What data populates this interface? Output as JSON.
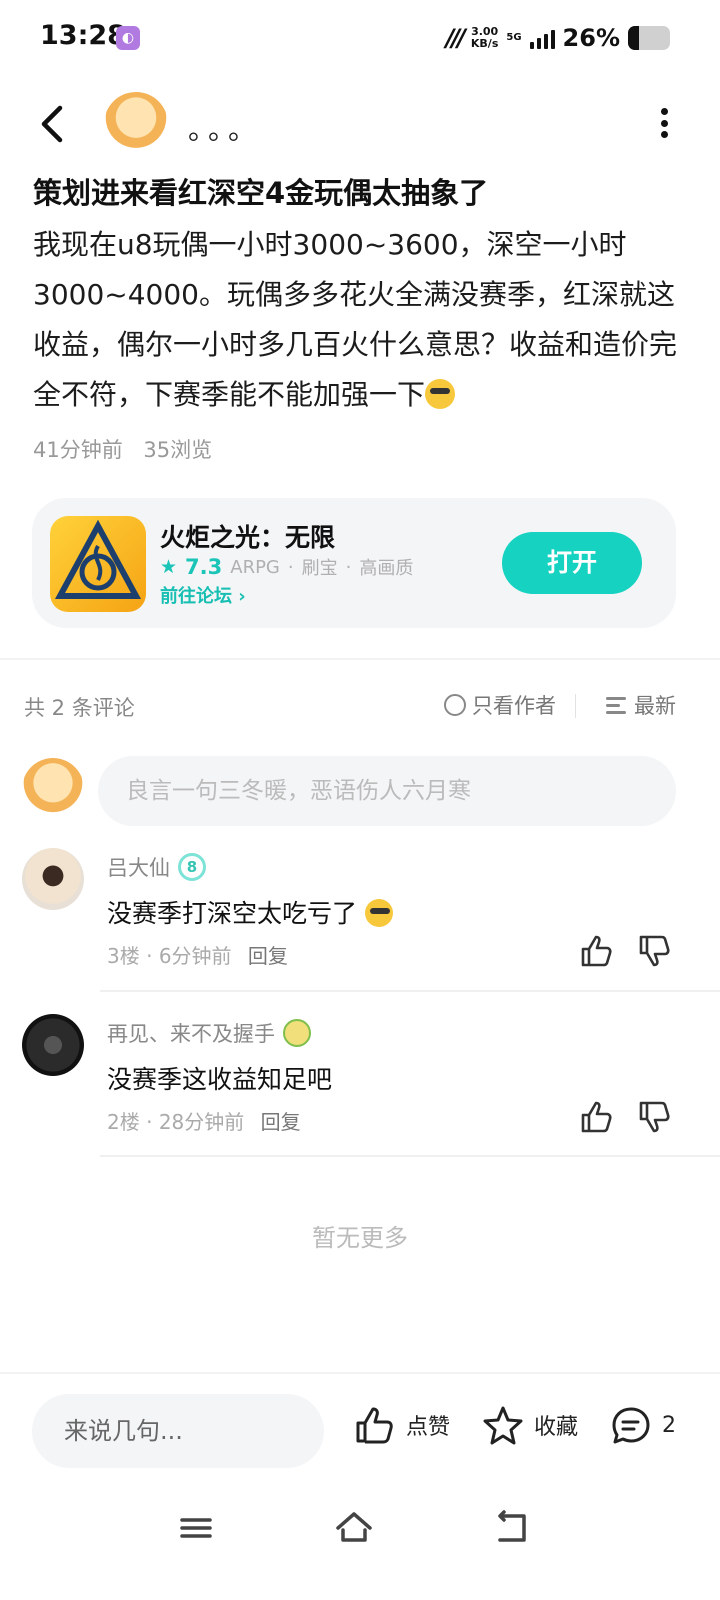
{
  "status_bar": {
    "time": "13:28",
    "net_speed_value": "3.00",
    "net_speed_unit": "KB/s",
    "network_type": "5G",
    "battery_percent": "26%",
    "battery_level": 0.26
  },
  "header": {
    "author_name": "。。。"
  },
  "post": {
    "title": "策划进来看红深空4金玩偶太抽象了",
    "body": "我现在u8玩偶一小时3000~3600，深空一小时3000~4000。玩偶多多花火全满没赛季，红深就这收益，偶尔一小时多几百火什么意思？收益和造价完全不符，下赛季能不能加强一下",
    "time_ago": "41分钟前",
    "views": "35浏览"
  },
  "game_card": {
    "name": "火炬之光：无限",
    "score": "7.3",
    "tags": [
      "ARPG",
      "刷宝",
      "高画质"
    ],
    "forum_link": "前往论坛",
    "open_label": "打开",
    "accent_color": "#16d2c0"
  },
  "comments_section": {
    "count_label": "共 2 条评论",
    "only_author_label": "只看作者",
    "sort_label": "最新",
    "input_placeholder": "良言一句三冬暖，恶语伤人六月寒",
    "no_more": "暂无更多",
    "items": [
      {
        "name": "吕大仙",
        "level": "8",
        "text": "没赛季打深空太吃亏了",
        "floor": "3楼",
        "time": "6分钟前",
        "reply": "回复"
      },
      {
        "name": "再见、来不及握手",
        "text": "没赛季这收益知足吧",
        "floor": "2楼",
        "time": "28分钟前",
        "reply": "回复"
      }
    ]
  },
  "bottom_bar": {
    "say_placeholder": "来说几句...",
    "like_label": "点赞",
    "favorite_label": "收藏",
    "comment_count": "2"
  }
}
